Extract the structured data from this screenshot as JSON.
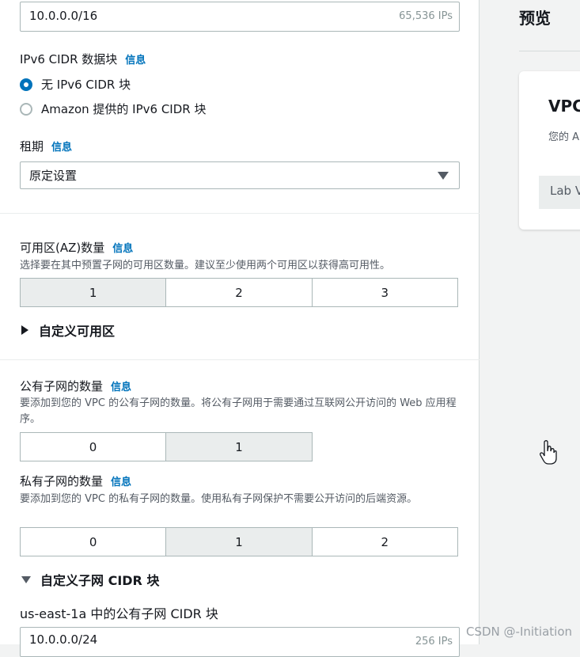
{
  "form": {
    "cidr_value": "10.0.0.0/16",
    "cidr_ips": "65,536 IPs",
    "ipv6": {
      "label": "IPv6 CIDR 数据块",
      "info": "信息",
      "option_none": "无 IPv6 CIDR 块",
      "option_amazon": "Amazon 提供的 IPv6 CIDR 块",
      "selected": "none"
    },
    "tenancy": {
      "label": "租期",
      "info": "信息",
      "selected": "原定设置"
    },
    "az": {
      "label": "可用区(AZ)数量",
      "info": "信息",
      "description": "选择要在其中预置子网的可用区数量。建议至少使用两个可用区以获得高可用性。",
      "options": [
        "1",
        "2",
        "3"
      ],
      "selected": "1",
      "customize": "自定义可用区"
    },
    "public_subnets": {
      "label": "公有子网的数量",
      "info": "信息",
      "description": "要添加到您的 VPC 的公有子网的数量。将公有子网用于需要通过互联网公开访问的 Web 应用程序。",
      "options": [
        "0",
        "1"
      ],
      "selected": "1"
    },
    "private_subnets": {
      "label": "私有子网的数量",
      "info": "信息",
      "description": "要添加到您的 VPC 的私有子网的数量。使用私有子网保护不需要公开访问的后端资源。",
      "options": [
        "0",
        "1",
        "2"
      ],
      "selected": "1"
    },
    "customize_cidr": "自定义子网 CIDR 块",
    "public_subnet_cidr_label": "us-east-1a 中的公有子网 CIDR 块",
    "public_subnet_cidr_value": "10.0.0.0/24",
    "public_subnet_cidr_ips": "256 IPs"
  },
  "preview": {
    "title": "预览",
    "card_title": "VPC",
    "card_subtitle": "您的 A",
    "chip": "Lab V"
  },
  "watermark": "CSDN @-Initiation"
}
